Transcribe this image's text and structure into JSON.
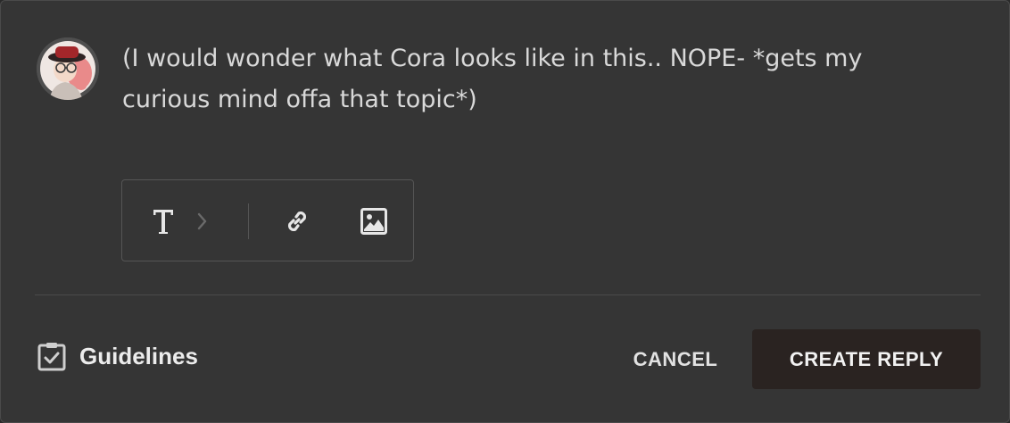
{
  "reply": {
    "text": "(I would wonder what Cora looks like in this.. NOPE- *gets my\ncurious mind offa that topic*)"
  },
  "avatar": {
    "icon": "user-avatar-cartoon"
  },
  "toolbar": {
    "items": [
      {
        "icon": "text-format-icon"
      },
      {
        "icon": "chevron-right-icon"
      },
      {
        "icon": "link-icon"
      },
      {
        "icon": "image-icon"
      }
    ]
  },
  "footer": {
    "guidelines_label": "Guidelines",
    "cancel_label": "CANCEL",
    "create_label": "CREATE REPLY"
  },
  "colors": {
    "panel_bg": "#353535",
    "text": "#d9d9d9",
    "primary_button_bg": "#2a2321"
  }
}
